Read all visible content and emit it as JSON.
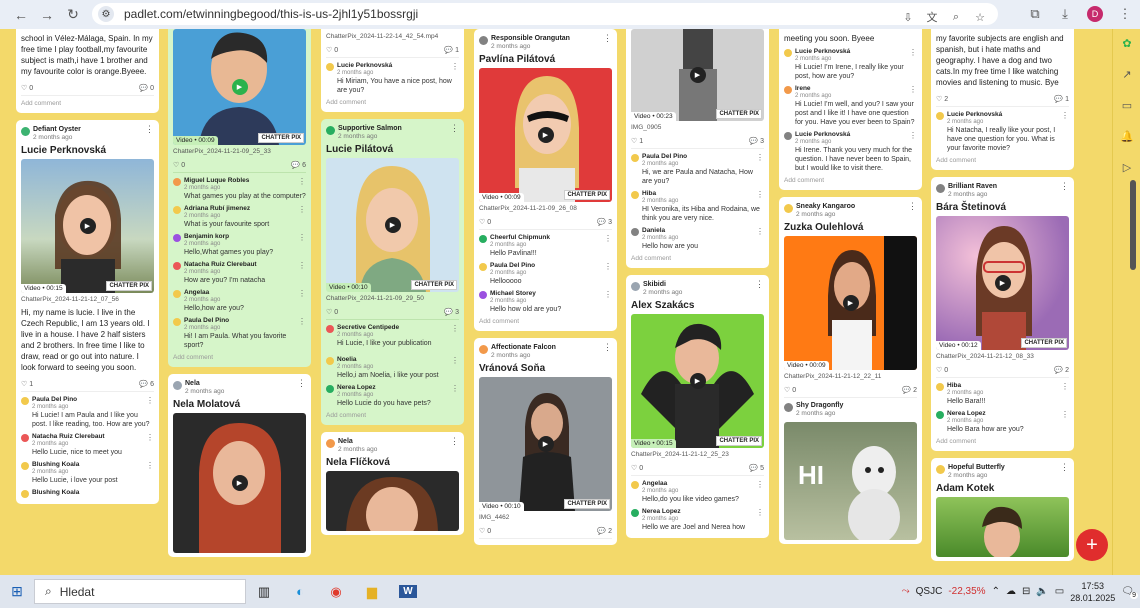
{
  "browser": {
    "url": "padlet.com/etwinningbegood/this-is-us-2jhl1y51bossrgji",
    "profile": "D"
  },
  "col1": {
    "top_text": "school in Vélez-Málaga, Spain. In my free time I play football,my favourite subject is math,i have 1 brother and my favourite color is orange.Byeee.",
    "top_likes": "0",
    "top_comments": "0",
    "add_comment": "Add comment",
    "card": {
      "author": "Defiant Oyster",
      "time": "2 months ago",
      "title": "Lucie Perknovská",
      "video": "Video • 00:15",
      "chatterpix": "CHATTER PIX",
      "file": "ChatterPix_2024-11-21-12_07_56",
      "text": "Hi, my name is lucie. I live in the Czech Republic, I am 13 years old. I live in a house. I have 2 half sisters and 2 brothers. In free time I like to draw, read or go out into nature. I look forward to seeing you soon.",
      "likes": "1",
      "comments": "6",
      "cm": [
        {
          "name": "Paula Del Pino",
          "time": "2 months ago",
          "text": "Hi Lucie! I am Paula and I like you post. I like reading, too. How are you?"
        },
        {
          "name": "Natacha Ruiz Clerebaut",
          "time": "2 months ago",
          "text": "Hello Lucie, nice to meet you"
        },
        {
          "name": "Blushing Koala",
          "time": "2 months ago",
          "text": "Hello Lucie, i love your post"
        },
        {
          "name": "Blushing Koala",
          "time": "",
          "text": ""
        }
      ]
    }
  },
  "col2": {
    "top": {
      "video": "Video • 00:09",
      "chatterpix": "CHATTER PIX",
      "file": "ChatterPix_2024-11-21-09_25_33",
      "likes": "0",
      "comments": "6",
      "cm": [
        {
          "name": "Miguel Luque Robles",
          "time": "2 months ago",
          "text": "What games you play at the computer?"
        },
        {
          "name": "Adriana Rubí jimenez",
          "time": "2 months ago",
          "text": "What is your favourite sport"
        },
        {
          "name": "Benjamin korp",
          "time": "2 months ago",
          "text": "Hello,What games you play?"
        },
        {
          "name": "Natacha Ruiz Clerebaut",
          "time": "2 months ago",
          "text": "How are you? I'm natacha"
        },
        {
          "name": "Angelaa",
          "time": "2 months ago",
          "text": "Hello,how are you?"
        },
        {
          "name": "Paula Del Pino",
          "time": "2 months ago",
          "text": "Hi! I am Paula. What you favorite sport?"
        }
      ],
      "add_comment": "Add comment"
    },
    "card": {
      "author": "Nela",
      "time": "2 months ago",
      "title": "Nela Molatová"
    }
  },
  "col3": {
    "top": {
      "file": "ChatterPix_2024-11-22-14_42_54.mp4",
      "likes": "0",
      "comments": "1",
      "cm": [
        {
          "name": "Lucie Perknovská",
          "time": "2 months ago",
          "text": "Hi Miriam, You have a nice post, how are you?"
        }
      ],
      "add_comment": "Add comment"
    },
    "card": {
      "author": "Supportive Salmon",
      "time": "2 months ago",
      "title": "Lucie Pilátová",
      "video": "Video • 00:10",
      "chatterpix": "CHATTER PIX",
      "file": "ChatterPix_2024-11-21-09_29_50",
      "likes": "0",
      "comments": "3",
      "cm": [
        {
          "name": "Secretive Centipede",
          "time": "2 months ago",
          "text": "Hi Lucie, I like your publication"
        },
        {
          "name": "Noelia",
          "time": "2 months ago",
          "text": "Hello,i am Noelia, i like your post"
        },
        {
          "name": "Nerea Lopez",
          "time": "2 months ago",
          "text": "Hello Lucie do you have pets?"
        }
      ],
      "add_comment": "Add comment"
    },
    "card2": {
      "author": "Nela",
      "time": "2 months ago",
      "title": "Nela Flíčková"
    }
  },
  "col4": {
    "card": {
      "author": "Responsible Orangutan",
      "time": "2 months ago",
      "title": "Pavlína Pilátová",
      "video": "Video • 00:09",
      "chatterpix": "CHATTER PIX",
      "file": "ChatterPix_2024-11-21-09_26_08",
      "likes": "0",
      "comments": "3",
      "cm": [
        {
          "name": "Cheerful Chipmunk",
          "time": "2 months ago",
          "text": "Hello Pavlina!!!"
        },
        {
          "name": "Paula Del Pino",
          "time": "2 months ago",
          "text": "Hellooooo"
        },
        {
          "name": "Michael Storey",
          "time": "2 months ago",
          "text": "Hello how old are you?"
        }
      ],
      "add_comment": "Add comment"
    },
    "card2": {
      "author": "Affectionate Falcon",
      "time": "2 months ago",
      "title": "Vránová Soňa",
      "video": "Video • 00:10",
      "chatterpix": "CHATTER PIX",
      "file": "IMG_4462",
      "likes": "0",
      "comments": "2"
    }
  },
  "col5": {
    "top": {
      "video": "Video • 00:23",
      "chatterpix": "CHATTER PIX",
      "file": "IMG_0905",
      "likes": "1",
      "comments": "3",
      "cm": [
        {
          "name": "Paula Del Pino",
          "time": "2 months ago",
          "text": "Hi, we are Paula and Natacha, How are you?"
        },
        {
          "name": "Hiba",
          "time": "2 months ago",
          "text": "HI Veronika, its Hiba and Rodaina, we think you are very nice."
        },
        {
          "name": "Daniela",
          "time": "2 months ago",
          "text": "Hello how are you"
        }
      ],
      "add_comment": "Add comment"
    },
    "card": {
      "author": "Skibidi",
      "time": "2 months ago",
      "title": "Alex Szakács",
      "video": "Video • 00:15",
      "chatterpix": "CHATTER PIX",
      "file": "ChatterPix_2024-11-21-12_25_23",
      "likes": "0",
      "comments": "5",
      "cm": [
        {
          "name": "Angelaa",
          "time": "2 months ago",
          "text": "Hello,do you like video games?"
        },
        {
          "name": "Nerea Lopez",
          "time": "2 months ago",
          "text": "Hello we are Joel and Nerea how"
        }
      ]
    }
  },
  "col6": {
    "top": {
      "top_text": "meeting you soon. Byeee",
      "cm": [
        {
          "name": "Lucie Perknovská",
          "time": "2 months ago",
          "text": "Hi Lucie! I'm Irene, I really like your post, how are you?"
        },
        {
          "name": "Irene",
          "time": "2 months ago",
          "text": "Hi Lucie! I'm well, and you? I saw your post and I like it! I have one question for you. Have you ever been to Spain?"
        },
        {
          "name": "Lucie Perknovská",
          "time": "2 months ago",
          "text": "Hi Irene. Thank you very much for the question. I have never been to Spain, but I would like to visit there."
        }
      ],
      "add_comment": "Add comment"
    },
    "card": {
      "author": "Sneaky Kangaroo",
      "time": "2 months ago",
      "title": "Zuzka Oulehlová",
      "video": "Video • 00:09",
      "file": "ChatterPix_2024-11-21-12_22_11",
      "likes": "0",
      "comments": "2"
    },
    "card2": {
      "author": "Shy Dragonfly",
      "time": "2 months ago",
      "hi": "HI"
    }
  },
  "col7": {
    "top": {
      "top_text": "my favorite subjects are english and spanish, but i hate maths and geography. I have a dog and two cats.In my free time I like watching movies and listening to music. Bye",
      "likes": "2",
      "comments": "1",
      "cm": [
        {
          "name": "Lucie Perknovská",
          "time": "2 months ago",
          "text": "Hi Natacha, I really like your post, I have one question for you. What is your favorite movie?"
        }
      ],
      "add_comment": "Add comment"
    },
    "card": {
      "author": "Brilliant Raven",
      "time": "2 months ago",
      "title": "Bára Štetinová",
      "video": "Video • 00:12",
      "chatterpix": "CHATTER PIX",
      "file": "ChatterPix_2024-11-21-12_08_33",
      "likes": "0",
      "comments": "2",
      "cm": [
        {
          "name": "Hiba",
          "time": "2 months ago",
          "text": "Hello Bara!!!"
        },
        {
          "name": "Nerea Lopez",
          "time": "2 months ago",
          "text": "Hello Bara how are you?"
        }
      ],
      "add_comment": "Add comment"
    },
    "card2": {
      "author": "Hopeful Butterfly",
      "time": "2 months ago",
      "title": "Adam Kotek"
    }
  },
  "taskbar": {
    "search": "Hledat",
    "stock_name": "QSJC",
    "stock_change": "-22,35%",
    "time": "17:53",
    "date": "28.01.2025",
    "notif": "9"
  },
  "colors": {
    "board": "#f3d96a",
    "fab": "#e02d2d",
    "stock_negative": "#d03030"
  }
}
